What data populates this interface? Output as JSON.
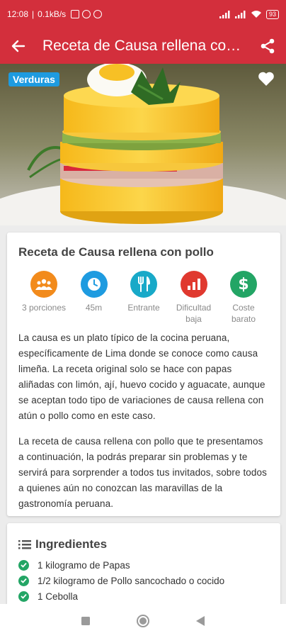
{
  "status": {
    "time": "12:08",
    "net_speed": "0.1kB/s",
    "battery": "93"
  },
  "app_bar": {
    "title": "Receta de Causa rellena con pollo"
  },
  "hero": {
    "tag": "Verduras",
    "favorite_icon": "heart-icon"
  },
  "recipe": {
    "title": "Receta de Causa rellena con pollo",
    "stats": [
      {
        "icon": "people-icon",
        "label": "3 porciones",
        "color": "#f28b1c"
      },
      {
        "icon": "clock-icon",
        "label": "45m",
        "color": "#1e9be0"
      },
      {
        "icon": "utensils-icon",
        "label": "Entrante",
        "color": "#18a9c8"
      },
      {
        "icon": "bar-chart-icon",
        "label": "Dificultad baja",
        "color": "#e0392f"
      },
      {
        "icon": "dollar-icon",
        "label": "Coste barato",
        "color": "#23a565"
      }
    ],
    "description": [
      "La causa es un plato típico de la cocina peruana, específicamente de Lima donde se conoce como causa limeña. La receta original solo se hace con papas aliñadas con limón, ají, huevo cocido y aguacate, aunque se aceptan todo tipo de variaciones de causa rellena con atún o pollo como en este caso.",
      "La receta de causa rellena con pollo que te presentamos a continuación, la podrás preparar sin problemas y te servirá para sorprender a todos tus invitados, sobre todos a quienes aún no conozcan las maravillas de la gastronomía peruana."
    ]
  },
  "ingredients": {
    "heading": "Ingredientes",
    "items": [
      "1 kilogramo de Papas",
      "1/2 kilogramo de Pollo sancochado o cocido",
      "1 Cebolla"
    ]
  },
  "colors": {
    "primary": "#d32f3c",
    "tag": "#1e9be0",
    "check": "#23a565"
  }
}
